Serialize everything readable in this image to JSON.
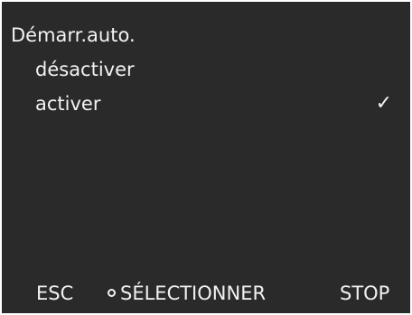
{
  "screen": {
    "title": "Démarr.auto.",
    "options": [
      {
        "label": "désactiver",
        "selected": false
      },
      {
        "label": "activer",
        "selected": true
      }
    ],
    "check_glyph": "✓",
    "check_icon": "checkmark-icon"
  },
  "softkeys": {
    "esc": "ESC",
    "select": "SÉLECTIONNER",
    "select_icon": "circle-icon",
    "stop": "STOP"
  },
  "colors": {
    "background": "#2a2a2a",
    "text": "#f2f2f2"
  }
}
